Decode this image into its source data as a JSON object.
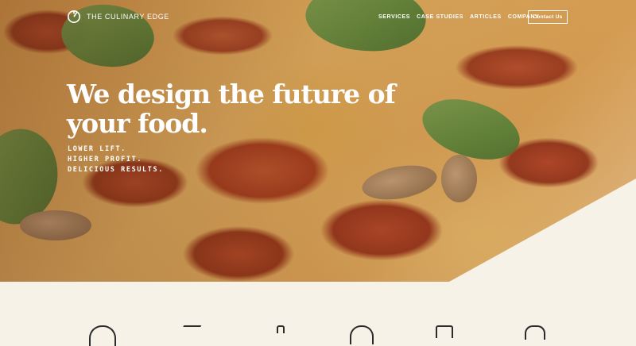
{
  "brand": {
    "name": "THE CULINARY EDGE",
    "color": "#ffffff"
  },
  "nav": {
    "items": [
      {
        "label": "SERVICES"
      },
      {
        "label": "CASE STUDIES"
      },
      {
        "label": "ARTICLES"
      },
      {
        "label": "COMPANY"
      }
    ],
    "cta_label": "Contact Us"
  },
  "hero": {
    "headline_line1": "We design the future of",
    "headline_line2": "your food.",
    "taglines": [
      "LOWER LIFT.",
      "HIGHER PROFIT.",
      "DELICIOUS RESULTS."
    ]
  },
  "icons": {
    "logo": "culinary-edge-logo-icon",
    "row": [
      "service-icon-1",
      "service-icon-2",
      "service-icon-3",
      "service-icon-4",
      "service-icon-5",
      "service-icon-6"
    ]
  },
  "colors": {
    "background": "#f6f2e8",
    "text_light": "#ffffff",
    "icon_stroke": "#2b2b2b"
  }
}
